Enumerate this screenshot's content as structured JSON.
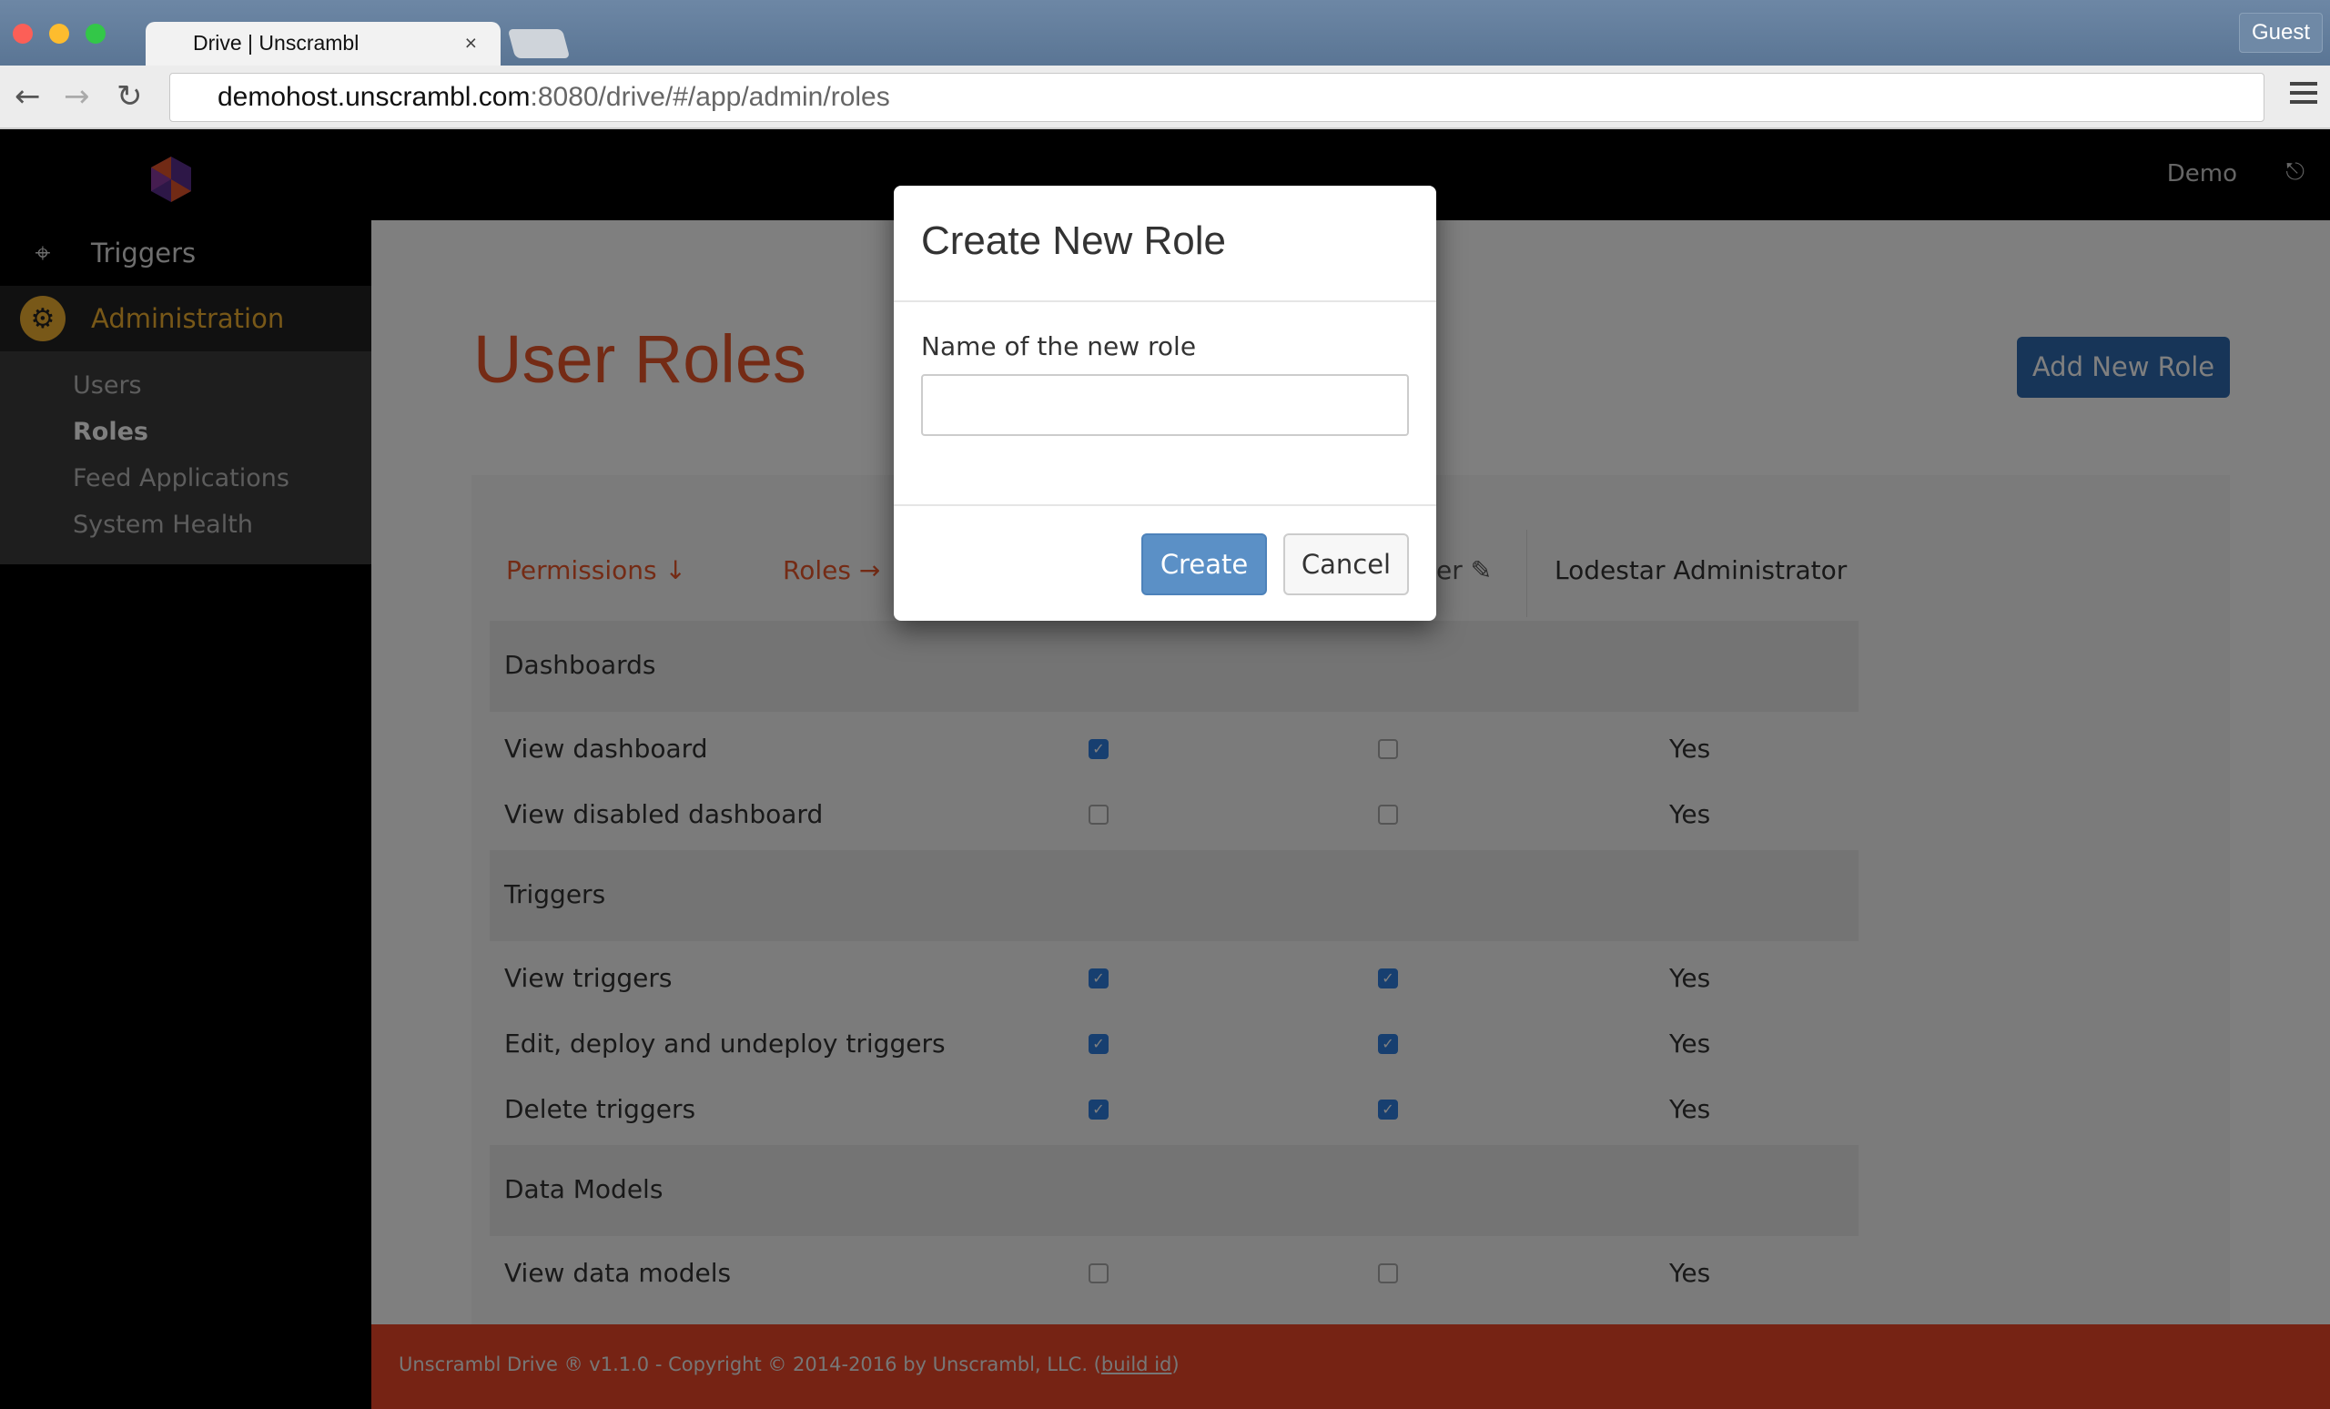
{
  "browser": {
    "tab_title": "Drive | Unscrambl",
    "tab_close": "×",
    "url_host": "demohost.unscrambl.com",
    "url_rest": ":8080/drive/#/app/admin/roles",
    "guest_label": "Guest",
    "back": "←",
    "forward": "→",
    "reload": "↻"
  },
  "header": {
    "user": "Demo",
    "logout_icon": "⎋"
  },
  "sidebar": {
    "items": [
      {
        "label": "Triggers",
        "icon": "crosshair-icon",
        "glyph": "⌖"
      },
      {
        "label": "Administration",
        "icon": "gear-icon",
        "glyph": "⚙"
      }
    ],
    "subitems": [
      {
        "label": "Users"
      },
      {
        "label": "Roles"
      },
      {
        "label": "Feed Applications"
      },
      {
        "label": "System Health"
      }
    ]
  },
  "main": {
    "title": "User Roles",
    "add_button": "Add New Role",
    "table": {
      "corner_permissions": "Permissions ↓",
      "corner_roles": "Roles →",
      "role_headers": [
        "er ✎",
        "Lodestar Administrator"
      ],
      "sections": [
        {
          "name": "Dashboards",
          "rows": [
            {
              "label": "View dashboard",
              "c1": true,
              "c2": false,
              "c3": "Yes"
            },
            {
              "label": "View disabled dashboard",
              "c1": false,
              "c2": false,
              "c3": "Yes"
            }
          ]
        },
        {
          "name": "Triggers",
          "rows": [
            {
              "label": "View triggers",
              "c1": true,
              "c2": true,
              "c3": "Yes"
            },
            {
              "label": "Edit, deploy and undeploy triggers",
              "c1": true,
              "c2": true,
              "c3": "Yes"
            },
            {
              "label": "Delete triggers",
              "c1": true,
              "c2": true,
              "c3": "Yes"
            }
          ]
        },
        {
          "name": "Data Models",
          "rows": [
            {
              "label": "View data models",
              "c1": false,
              "c2": false,
              "c3": "Yes"
            }
          ]
        }
      ]
    }
  },
  "footer": {
    "text": "Unscrambl Drive ® v1.1.0 - Copyright © 2014-2016 by Unscrambl, LLC. (",
    "link": "build id",
    "close": ")"
  },
  "modal": {
    "title": "Create New Role",
    "field_label": "Name of the new role",
    "field_value": "",
    "create": "Create",
    "cancel": "Cancel"
  },
  "colors": {
    "accent": "#e9572a",
    "primary": "#2e6bb0",
    "footer": "#ec4728",
    "active": "#f0b030"
  }
}
